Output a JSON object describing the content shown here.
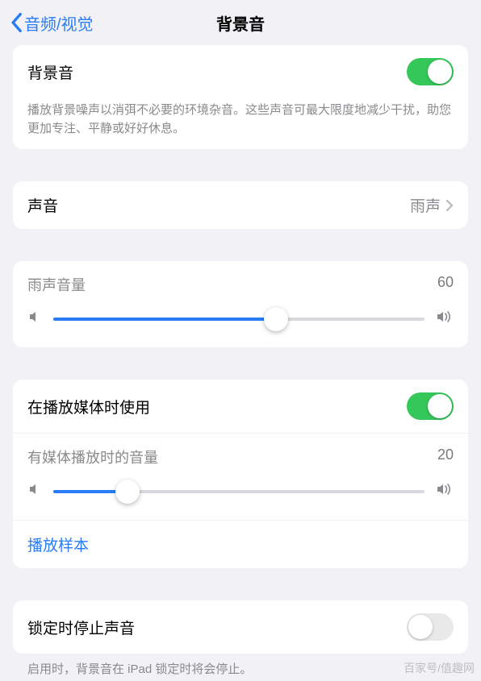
{
  "header": {
    "back_label": "音频/视觉",
    "title": "背景音"
  },
  "master": {
    "label": "背景音",
    "on": true,
    "footer": "播放背景噪声以消弭不必要的环境杂音。这些声音可最大限度地减少干扰，助您更加专注、平静或好好休息。"
  },
  "sound_row": {
    "label": "声音",
    "value": "雨声"
  },
  "volume1": {
    "label": "雨声音量",
    "value": 60
  },
  "media": {
    "toggle_label": "在播放媒体时使用",
    "toggle_on": true,
    "vol_label": "有媒体播放时的音量",
    "vol_value": 20,
    "sample_label": "播放样本"
  },
  "lock": {
    "label": "锁定时停止声音",
    "on": false,
    "footer": "启用时，背景音在 iPad 锁定时将会停止。"
  },
  "watermark": "百家号/值趣网"
}
